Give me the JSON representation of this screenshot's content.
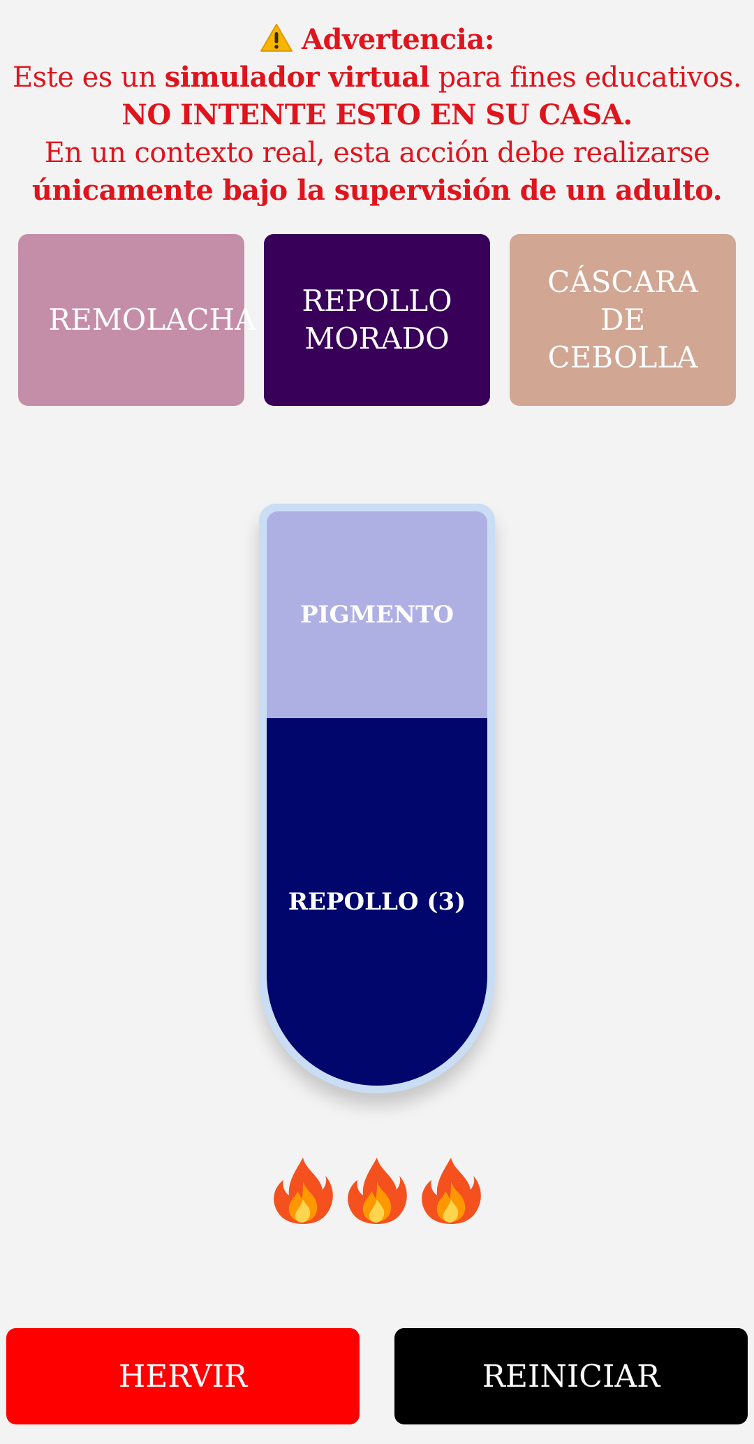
{
  "warning": {
    "title": "Advertencia:",
    "line2_pre": "Este es un ",
    "line2_bold": "simulador virtual",
    "line2_post": " para fines educativos.",
    "line3": "NO INTENTE ESTO EN SU CASA.",
    "line4": "En un contexto real, esta acción debe realizarse",
    "line5": "únicamente bajo la supervisión de un adulto.",
    "color": "#e0141c"
  },
  "ingredients": [
    {
      "label": "REMOLACHA",
      "color": "#c48ea8"
    },
    {
      "label_line1": "REPOLLO",
      "label_line2": "MORADO",
      "color": "#380058"
    },
    {
      "label_line1": "CÁSCARA",
      "label_line2": "DE",
      "label_line3": "CEBOLLA",
      "color": "#d1a693"
    }
  ],
  "tube": {
    "top_layer": {
      "label": "PIGMENTO",
      "color": "#aeb0e4"
    },
    "bottom_layer": {
      "label": "REPOLLO (3)",
      "color": "#00066b"
    },
    "glass_color": "#c9def5"
  },
  "flames": {
    "count": 3,
    "icon": "fire-icon"
  },
  "buttons": {
    "boil": {
      "label": "HERVIR",
      "color": "#ff0000"
    },
    "reset": {
      "label": "REINICIAR",
      "color": "#000000"
    }
  }
}
